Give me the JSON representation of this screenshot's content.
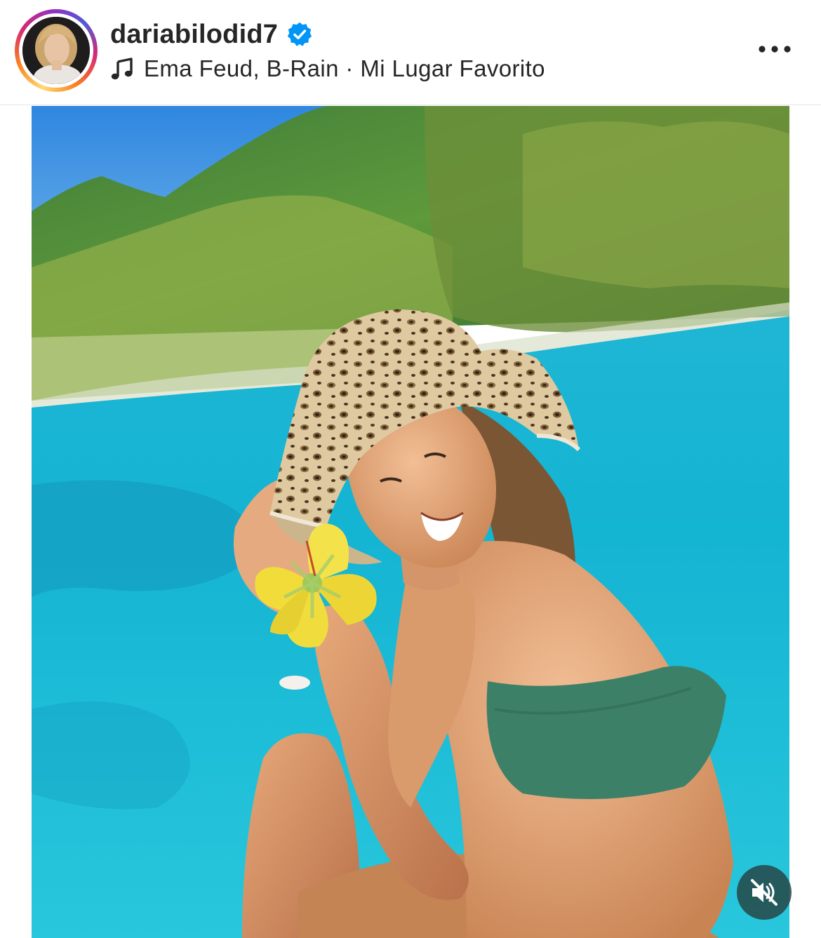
{
  "post": {
    "username": "dariabilodid7",
    "verified": true,
    "music_label": "Ema Feud, B-Rain · Mi Lugar Favorito"
  },
  "icons": {
    "verified": "verified-badge-icon",
    "music": "music-note-icon",
    "more": "more-options-icon",
    "mute": "speaker-muted-icon"
  },
  "colors": {
    "verified_blue": "#0095f6",
    "text_primary": "#262626",
    "mute_button_bg": "#264646"
  }
}
